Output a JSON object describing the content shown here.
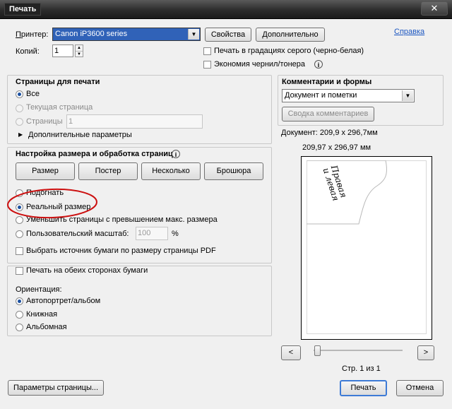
{
  "window": {
    "title": "Печать",
    "close_glyph": "✕"
  },
  "printer": {
    "label": "Принтер:",
    "selected": "Canon iP3600 series",
    "properties_btn": "Свойства",
    "advanced_btn": "Дополнительно",
    "help_link": "Справка",
    "copies_label": "Копий:",
    "copies_value": "1",
    "grayscale_label": "Печать в градациях серого (черно-белая)",
    "save_ink_label": "Экономия чернил/тонера",
    "info_glyph": "i"
  },
  "pages": {
    "heading": "Страницы для печати",
    "all": "Все",
    "current": "Текущая страница",
    "pages_label": "Страницы",
    "pages_value": "1",
    "more_options": "Дополнительные параметры",
    "arrow_glyph": "▶"
  },
  "sizing": {
    "heading": "Настройка размера и обработка страниц",
    "buttons": [
      "Размер",
      "Постер",
      "Несколько",
      "Брошюра"
    ],
    "fit": "Подогнать",
    "actual": "Реальный размер",
    "shrink": "Уменьшить страницы с превышением макс. размера",
    "custom_scale": "Пользовательский масштаб:",
    "scale_value": "100",
    "percent": "%",
    "paper_source": "Выбрать источник бумаги по размеру страницы PDF",
    "annotation_color": "#cc1010"
  },
  "duplex": {
    "label": "Печать на обеих сторонах бумаги",
    "orientation_label": "Ориентация:",
    "auto": "Автопортрет/альбом",
    "portrait": "Книжная",
    "landscape": "Альбомная"
  },
  "comments": {
    "heading": "Комментарии и формы",
    "selected": "Документ и пометки",
    "summary_btn": "Сводка комментариев"
  },
  "preview": {
    "doc_size": "Документ: 209,9 x 296,7мм",
    "paper_size": "209,97 x 296,97 мм",
    "page_text_line1": "Правая",
    "page_text_line2": "и левая",
    "prev_glyph": "<",
    "next_glyph": ">",
    "page_counter": "Стр. 1 из 1",
    "slider_position": 0
  },
  "footer": {
    "page_setup_btn": "Параметры страницы...",
    "print_btn": "Печать",
    "cancel_btn": "Отмена"
  }
}
